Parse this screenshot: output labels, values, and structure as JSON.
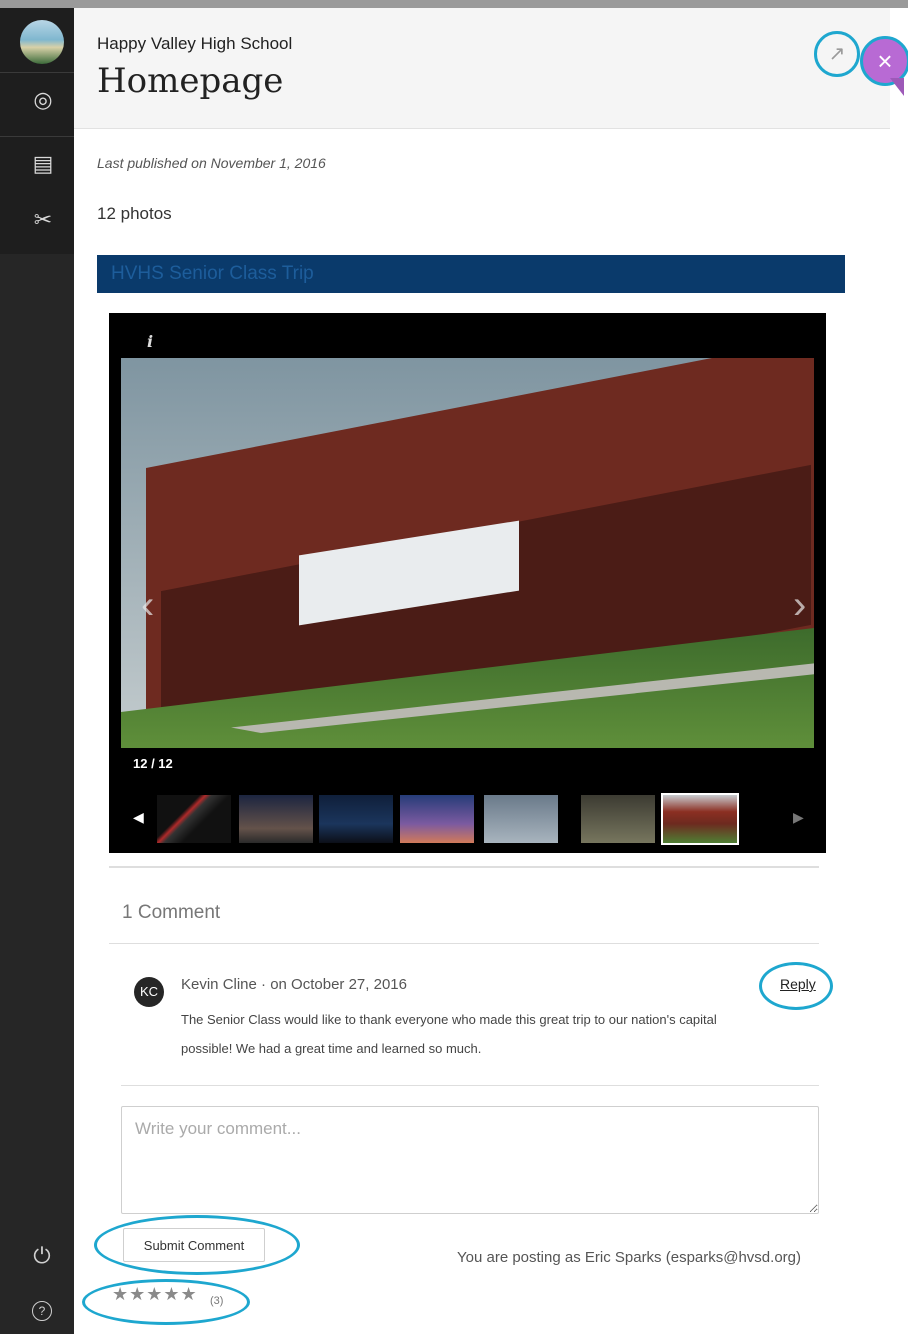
{
  "header": {
    "school": "Happy Valley High School",
    "title": "Homepage"
  },
  "page": {
    "last_published": "Last published on November 1, 2016",
    "photo_count": "12 photos",
    "album_title": "HVHS Senior Class Trip"
  },
  "gallery": {
    "counter": "12 / 12",
    "info_icon": "i",
    "prev_arrow": "‹",
    "next_arrow": "›",
    "thumbs_prev": "◀",
    "thumbs_next": "▶"
  },
  "comments": {
    "count_label": "1 Comment",
    "items": [
      {
        "avatar_initials": "KC",
        "byline": "Kevin Cline · on October 27, 2016",
        "text": "The Senior Class would like to thank everyone who made this great trip to our nation's capital possible! We had a great time and learned so much.",
        "reply_label": "Reply"
      }
    ],
    "input_placeholder": "Write your comment...",
    "submit_label": "Submit Comment",
    "posting_as": "You are posting as Eric Sparks (esparks@hvsd.org)"
  },
  "rating": {
    "stars": "★★★★★",
    "count": "(3)"
  },
  "icons": {
    "external": "↗",
    "close": "×",
    "globe": "🌐",
    "content": "▤",
    "tools": "✂",
    "power": "⏻",
    "help": "?"
  },
  "colors": {
    "accent": "#1ea7cf",
    "close_button": "#b86ad4",
    "album_bar": "#0a3a6b",
    "rail": "#262626"
  }
}
